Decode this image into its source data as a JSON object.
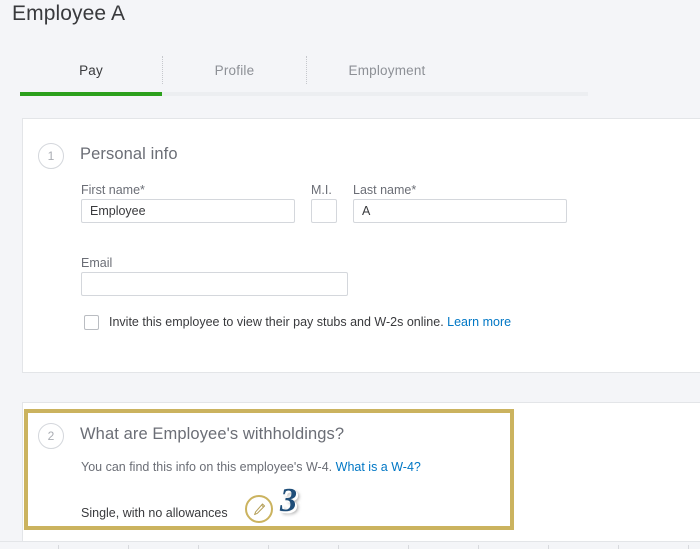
{
  "header": {
    "title": "Employee A"
  },
  "tabs": {
    "items": [
      {
        "id": "pay",
        "label": "Pay",
        "active": true
      },
      {
        "id": "profile",
        "label": "Profile",
        "active": false
      },
      {
        "id": "employment",
        "label": "Employment",
        "active": false
      }
    ],
    "active_underline_color": "#2ca01c"
  },
  "personal_info": {
    "step_number": "1",
    "heading": "Personal info",
    "fields": {
      "first_name": {
        "label": "First name*",
        "value": "Employee",
        "placeholder": ""
      },
      "middle_initial": {
        "label": "M.I.",
        "value": "",
        "placeholder": ""
      },
      "last_name": {
        "label": "Last name*",
        "value": "A",
        "placeholder": ""
      },
      "email": {
        "label": "Email",
        "value": "",
        "placeholder": ""
      }
    },
    "invite_checkbox": {
      "checked": false,
      "text": "Invite this employee to view their pay stubs and W-2s online.",
      "link_label": "Learn more"
    }
  },
  "withholdings": {
    "step_number": "2",
    "heading": "What are Employee's withholdings?",
    "sub_text": "You can find this info on this employee's W-4.",
    "sub_link_label": "What is a W-4?",
    "current_value": "Single, with no allowances",
    "edit_icon_name": "pencil-icon"
  },
  "annotations": {
    "highlight_color": "#cbb35f",
    "step_marker": "3",
    "step_marker_color": "#1f4e79"
  },
  "colors": {
    "page_background": "#f4f5f8",
    "card_background": "#ffffff",
    "card_border": "#e3e5e8",
    "brand_green": "#2ca01c",
    "link_blue": "#0077c5",
    "text_primary": "#393a3d",
    "text_secondary": "#6b6e76",
    "text_muted": "#8d9096"
  }
}
